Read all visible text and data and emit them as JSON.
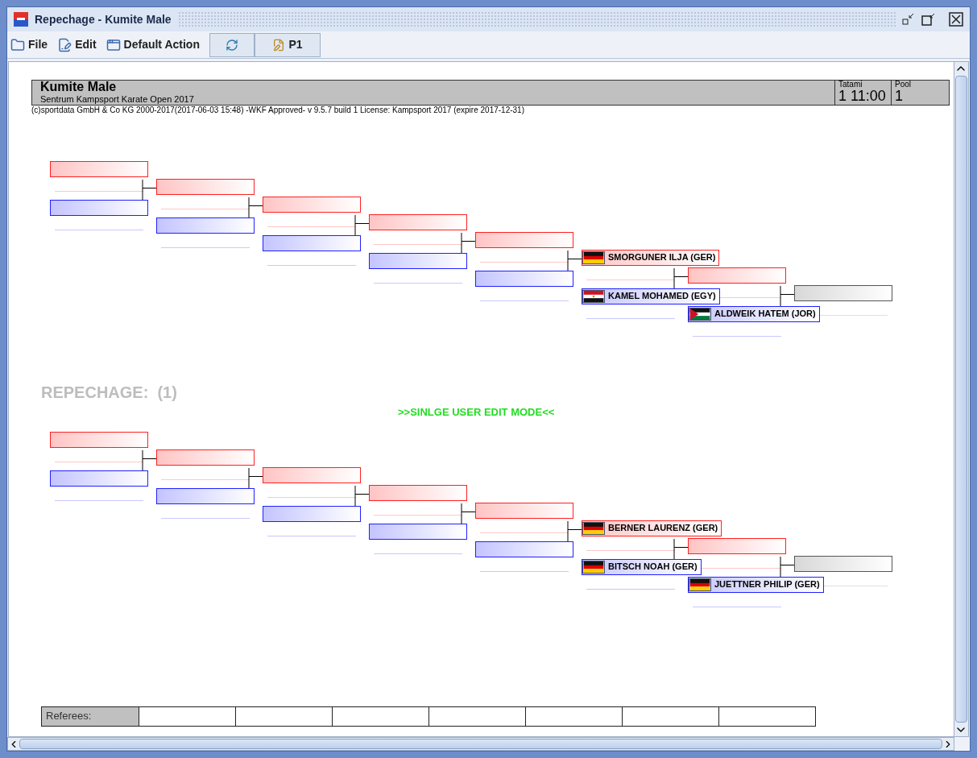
{
  "window": {
    "title": "Repechage - Kumite Male"
  },
  "toolbar": {
    "menus": [
      {
        "label": "File",
        "kind": "folder"
      },
      {
        "label": "Edit",
        "kind": "edit"
      },
      {
        "label": "Default Action",
        "kind": "action"
      }
    ],
    "tool_buttons": [
      {
        "kind": "refresh"
      },
      {
        "kind": "pages",
        "label": "P1"
      }
    ]
  },
  "header": {
    "title": "Kumite Male",
    "subtitle": "Sentrum Kampsport Karate Open 2017",
    "tatami": {
      "label": "Tatami",
      "value": "1 11:00"
    },
    "pool": {
      "label": "Pool",
      "value": "1"
    }
  },
  "copyright": "(c)sportdata GmbH & Co KG 2000-2017(2017-06-03 15:48) -WKF Approved- v 9.5.7 build 1 License: Kampsport 2017 (expire 2017-12-31)",
  "brackets": [
    {
      "rounds": [
        {
          "slots": [
            {
              "kind": "red"
            },
            {
              "kind": "blue"
            }
          ]
        },
        {
          "slots": [
            {
              "kind": "red"
            },
            {
              "kind": "blue"
            }
          ]
        },
        {
          "slots": [
            {
              "kind": "red"
            },
            {
              "kind": "blue"
            }
          ]
        },
        {
          "slots": [
            {
              "kind": "red"
            },
            {
              "kind": "blue"
            }
          ]
        },
        {
          "slots": [
            {
              "kind": "red"
            },
            {
              "kind": "blue"
            }
          ]
        },
        {
          "slots": [
            {
              "kind": "red",
              "name": "SMORGUNER ILJA (GER)",
              "flag": {
                "kind": "ger"
              }
            },
            {
              "kind": "blue",
              "name": "KAMEL MOHAMED (EGY)",
              "flag": {
                "kind": "egy"
              }
            }
          ]
        },
        {
          "slots": [
            {
              "kind": "red"
            },
            {
              "kind": "blue",
              "name": "ALDWEIK HATEM (JOR)",
              "flag": {
                "kind": "jor"
              }
            }
          ]
        },
        {
          "slots": [
            {
              "kind": "grey"
            }
          ]
        }
      ]
    },
    {
      "heading": "REPECHAGE:  (1)",
      "notice": ">>SINLGE USER EDIT MODE<<",
      "rounds": [
        {
          "slots": [
            {
              "kind": "red"
            },
            {
              "kind": "blue"
            }
          ]
        },
        {
          "slots": [
            {
              "kind": "red"
            },
            {
              "kind": "blue"
            }
          ]
        },
        {
          "slots": [
            {
              "kind": "red"
            },
            {
              "kind": "blue"
            }
          ]
        },
        {
          "slots": [
            {
              "kind": "red"
            },
            {
              "kind": "blue"
            }
          ]
        },
        {
          "slots": [
            {
              "kind": "red"
            },
            {
              "kind": "blue"
            }
          ]
        },
        {
          "slots": [
            {
              "kind": "red",
              "name": "BERNER LAURENZ (GER)",
              "flag": {
                "kind": "ger"
              }
            },
            {
              "kind": "blue",
              "name": "BITSCH NOAH (GER)",
              "flag": {
                "kind": "ger"
              }
            }
          ]
        },
        {
          "slots": [
            {
              "kind": "red"
            },
            {
              "kind": "blue",
              "name": "JUETTNER PHILIP (GER)",
              "flag": {
                "kind": "ger"
              }
            }
          ]
        },
        {
          "slots": [
            {
              "kind": "grey"
            }
          ]
        }
      ]
    }
  ],
  "referees": {
    "label": "Referees:"
  }
}
